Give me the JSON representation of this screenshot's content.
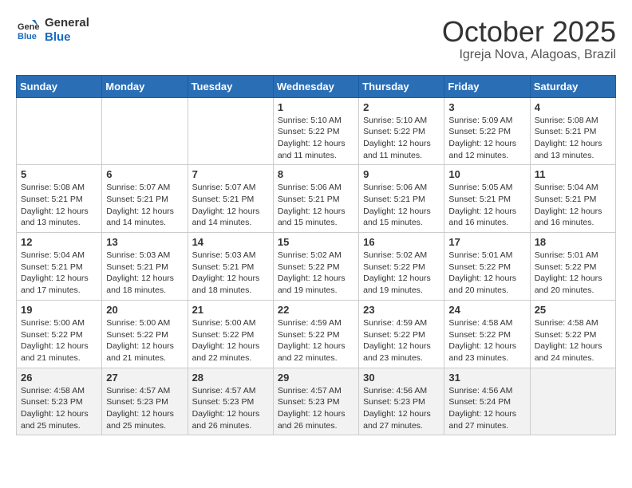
{
  "header": {
    "logo_general": "General",
    "logo_blue": "Blue",
    "month": "October 2025",
    "location": "Igreja Nova, Alagoas, Brazil"
  },
  "weekdays": [
    "Sunday",
    "Monday",
    "Tuesday",
    "Wednesday",
    "Thursday",
    "Friday",
    "Saturday"
  ],
  "weeks": [
    [
      {
        "day": "",
        "info": ""
      },
      {
        "day": "",
        "info": ""
      },
      {
        "day": "",
        "info": ""
      },
      {
        "day": "1",
        "info": "Sunrise: 5:10 AM\nSunset: 5:22 PM\nDaylight: 12 hours\nand 11 minutes."
      },
      {
        "day": "2",
        "info": "Sunrise: 5:10 AM\nSunset: 5:22 PM\nDaylight: 12 hours\nand 11 minutes."
      },
      {
        "day": "3",
        "info": "Sunrise: 5:09 AM\nSunset: 5:22 PM\nDaylight: 12 hours\nand 12 minutes."
      },
      {
        "day": "4",
        "info": "Sunrise: 5:08 AM\nSunset: 5:21 PM\nDaylight: 12 hours\nand 13 minutes."
      }
    ],
    [
      {
        "day": "5",
        "info": "Sunrise: 5:08 AM\nSunset: 5:21 PM\nDaylight: 12 hours\nand 13 minutes."
      },
      {
        "day": "6",
        "info": "Sunrise: 5:07 AM\nSunset: 5:21 PM\nDaylight: 12 hours\nand 14 minutes."
      },
      {
        "day": "7",
        "info": "Sunrise: 5:07 AM\nSunset: 5:21 PM\nDaylight: 12 hours\nand 14 minutes."
      },
      {
        "day": "8",
        "info": "Sunrise: 5:06 AM\nSunset: 5:21 PM\nDaylight: 12 hours\nand 15 minutes."
      },
      {
        "day": "9",
        "info": "Sunrise: 5:06 AM\nSunset: 5:21 PM\nDaylight: 12 hours\nand 15 minutes."
      },
      {
        "day": "10",
        "info": "Sunrise: 5:05 AM\nSunset: 5:21 PM\nDaylight: 12 hours\nand 16 minutes."
      },
      {
        "day": "11",
        "info": "Sunrise: 5:04 AM\nSunset: 5:21 PM\nDaylight: 12 hours\nand 16 minutes."
      }
    ],
    [
      {
        "day": "12",
        "info": "Sunrise: 5:04 AM\nSunset: 5:21 PM\nDaylight: 12 hours\nand 17 minutes."
      },
      {
        "day": "13",
        "info": "Sunrise: 5:03 AM\nSunset: 5:21 PM\nDaylight: 12 hours\nand 18 minutes."
      },
      {
        "day": "14",
        "info": "Sunrise: 5:03 AM\nSunset: 5:21 PM\nDaylight: 12 hours\nand 18 minutes."
      },
      {
        "day": "15",
        "info": "Sunrise: 5:02 AM\nSunset: 5:22 PM\nDaylight: 12 hours\nand 19 minutes."
      },
      {
        "day": "16",
        "info": "Sunrise: 5:02 AM\nSunset: 5:22 PM\nDaylight: 12 hours\nand 19 minutes."
      },
      {
        "day": "17",
        "info": "Sunrise: 5:01 AM\nSunset: 5:22 PM\nDaylight: 12 hours\nand 20 minutes."
      },
      {
        "day": "18",
        "info": "Sunrise: 5:01 AM\nSunset: 5:22 PM\nDaylight: 12 hours\nand 20 minutes."
      }
    ],
    [
      {
        "day": "19",
        "info": "Sunrise: 5:00 AM\nSunset: 5:22 PM\nDaylight: 12 hours\nand 21 minutes."
      },
      {
        "day": "20",
        "info": "Sunrise: 5:00 AM\nSunset: 5:22 PM\nDaylight: 12 hours\nand 21 minutes."
      },
      {
        "day": "21",
        "info": "Sunrise: 5:00 AM\nSunset: 5:22 PM\nDaylight: 12 hours\nand 22 minutes."
      },
      {
        "day": "22",
        "info": "Sunrise: 4:59 AM\nSunset: 5:22 PM\nDaylight: 12 hours\nand 22 minutes."
      },
      {
        "day": "23",
        "info": "Sunrise: 4:59 AM\nSunset: 5:22 PM\nDaylight: 12 hours\nand 23 minutes."
      },
      {
        "day": "24",
        "info": "Sunrise: 4:58 AM\nSunset: 5:22 PM\nDaylight: 12 hours\nand 23 minutes."
      },
      {
        "day": "25",
        "info": "Sunrise: 4:58 AM\nSunset: 5:22 PM\nDaylight: 12 hours\nand 24 minutes."
      }
    ],
    [
      {
        "day": "26",
        "info": "Sunrise: 4:58 AM\nSunset: 5:23 PM\nDaylight: 12 hours\nand 25 minutes."
      },
      {
        "day": "27",
        "info": "Sunrise: 4:57 AM\nSunset: 5:23 PM\nDaylight: 12 hours\nand 25 minutes."
      },
      {
        "day": "28",
        "info": "Sunrise: 4:57 AM\nSunset: 5:23 PM\nDaylight: 12 hours\nand 26 minutes."
      },
      {
        "day": "29",
        "info": "Sunrise: 4:57 AM\nSunset: 5:23 PM\nDaylight: 12 hours\nand 26 minutes."
      },
      {
        "day": "30",
        "info": "Sunrise: 4:56 AM\nSunset: 5:23 PM\nDaylight: 12 hours\nand 27 minutes."
      },
      {
        "day": "31",
        "info": "Sunrise: 4:56 AM\nSunset: 5:24 PM\nDaylight: 12 hours\nand 27 minutes."
      },
      {
        "day": "",
        "info": ""
      }
    ]
  ]
}
